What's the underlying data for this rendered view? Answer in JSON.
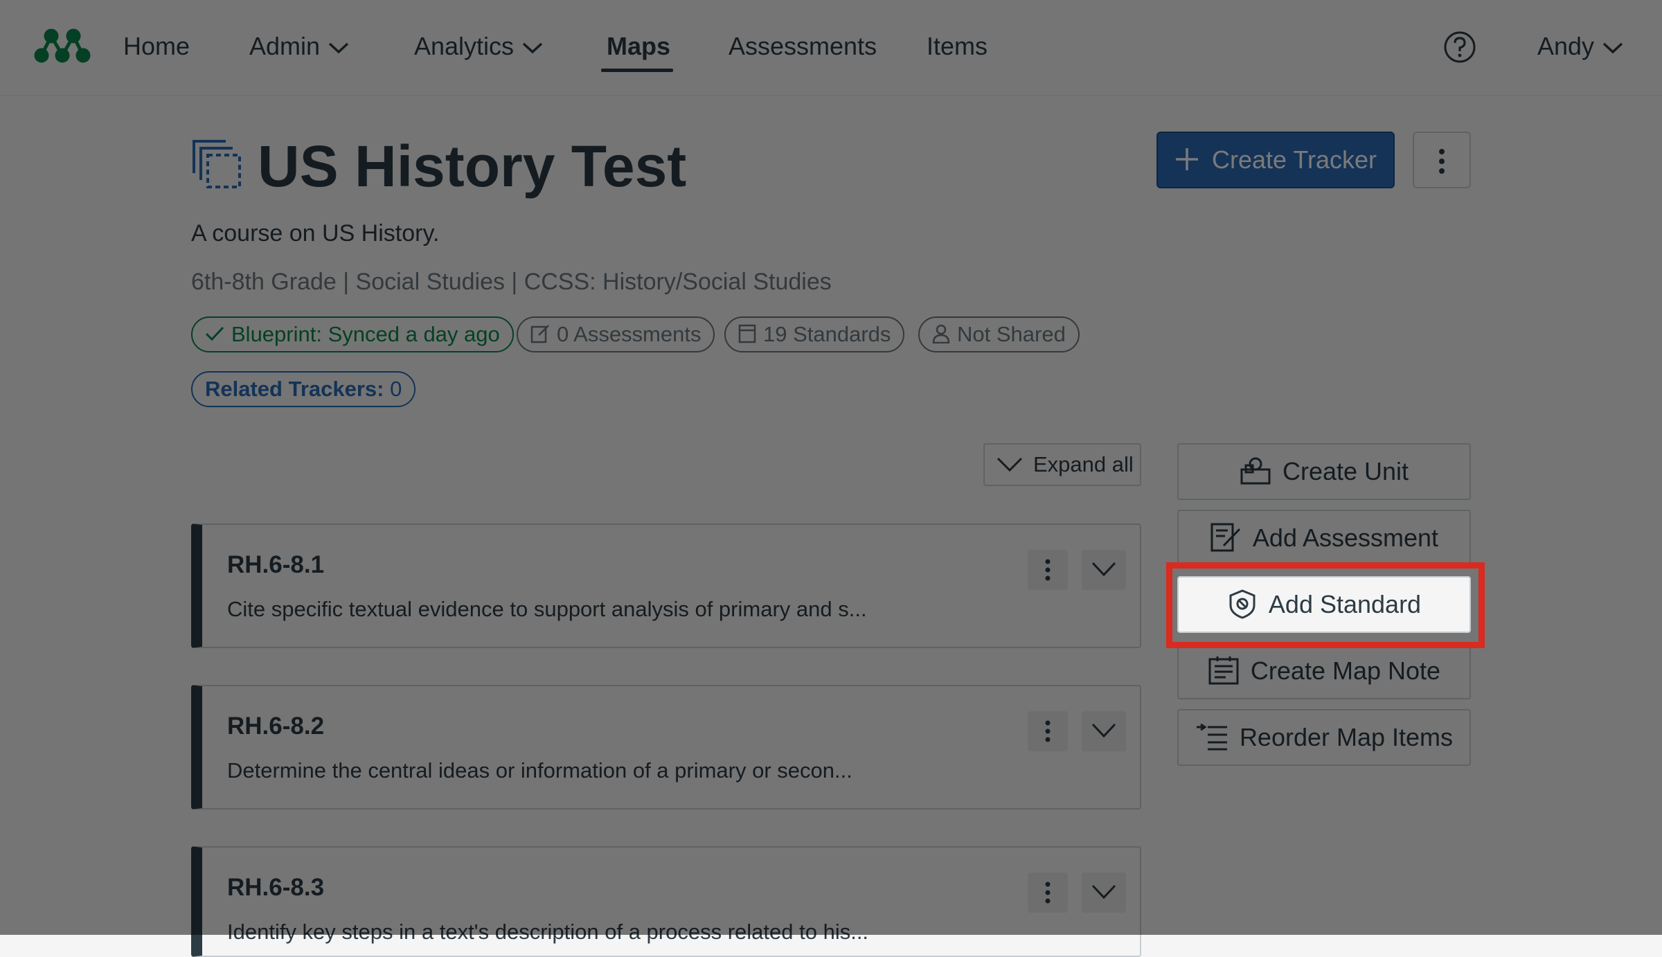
{
  "nav": {
    "items": [
      {
        "label": "Home"
      },
      {
        "label": "Admin"
      },
      {
        "label": "Analytics"
      },
      {
        "label": "Maps"
      },
      {
        "label": "Assessments"
      },
      {
        "label": "Items"
      }
    ],
    "active": "Maps",
    "user": "Andy"
  },
  "header": {
    "title": "US History Test",
    "description": "A course on US History.",
    "meta": "6th-8th Grade | Social Studies | CCSS: History/Social Studies",
    "create_tracker_label": "Create Tracker"
  },
  "badges": {
    "blueprint": "Blueprint: Synced a day ago",
    "assessments": "0 Assessments",
    "standards": "19 Standards",
    "shared": "Not Shared",
    "related_label": "Related Trackers:",
    "related_count": "0"
  },
  "expand_all_label": "Expand all",
  "standards": [
    {
      "code": "RH.6-8.1",
      "text": "Cite specific textual evidence to support analysis of primary and s..."
    },
    {
      "code": "RH.6-8.2",
      "text": "Determine the central ideas or information of a primary or secon..."
    },
    {
      "code": "RH.6-8.3",
      "text": "Identify key steps in a text's description of a process related to his..."
    }
  ],
  "actions": {
    "create_unit": "Create Unit",
    "add_assessment": "Add Assessment",
    "add_standard": "Add Standard",
    "create_map_note": "Create Map Note",
    "reorder_map_items": "Reorder Map Items"
  },
  "icons": [
    "logo-icon",
    "chevron-down-icon",
    "help-icon",
    "course-map-icon",
    "plus-icon",
    "kebab-icon",
    "check-icon",
    "edit-icon",
    "document-icon",
    "person-icon",
    "shapes-icon",
    "badge-icon",
    "note-icon",
    "reorder-icon"
  ],
  "colors": {
    "brand_blue": "#2b6cb7",
    "success_green": "#0b874b",
    "highlight_red": "#d92b1f",
    "text_dark": "#2d3b45"
  }
}
